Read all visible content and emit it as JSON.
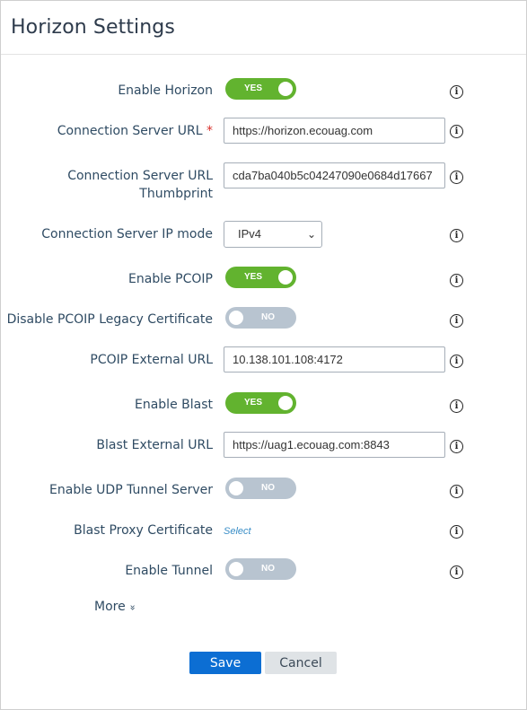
{
  "header": {
    "title": "Horizon Settings"
  },
  "form": {
    "enable_horizon": {
      "label": "Enable Horizon",
      "state": "YES"
    },
    "connection_server_url": {
      "label": "Connection Server URL",
      "required_mark": "*",
      "value": "https://horizon.ecouag.com"
    },
    "connection_server_thumbprint": {
      "label_line1": "Connection Server URL",
      "label_line2": "Thumbprint",
      "value": "cda7ba040b5c04247090e0684d17667"
    },
    "connection_server_ip_mode": {
      "label": "Connection Server IP mode",
      "value": "IPv4"
    },
    "enable_pcoip": {
      "label": "Enable PCOIP",
      "state": "YES"
    },
    "disable_pcoip_legacy_cert": {
      "label": "Disable PCOIP Legacy Certificate",
      "state": "NO"
    },
    "pcoip_external_url": {
      "label": "PCOIP External URL",
      "value": "10.138.101.108:4172"
    },
    "enable_blast": {
      "label": "Enable Blast",
      "state": "YES"
    },
    "blast_external_url": {
      "label": "Blast External URL",
      "value": "https://uag1.ecouag.com:8843"
    },
    "enable_udp_tunnel_server": {
      "label": "Enable UDP Tunnel Server",
      "state": "NO"
    },
    "blast_proxy_certificate": {
      "label": "Blast Proxy Certificate",
      "link": "Select"
    },
    "enable_tunnel": {
      "label": "Enable Tunnel",
      "state": "NO"
    }
  },
  "more": {
    "label": "More",
    "icon": "double-chevron-down-icon"
  },
  "info_icon": "i",
  "chevron_glyph": "⌄",
  "double_chevron_glyph": "»",
  "actions": {
    "save_label": "Save",
    "cancel_label": "Cancel"
  },
  "colors": {
    "toggle_on": "#62b32f",
    "toggle_off": "#b8c4d0",
    "primary": "#0c6ed3",
    "link": "#3a8ec7",
    "required": "#d9302b"
  }
}
